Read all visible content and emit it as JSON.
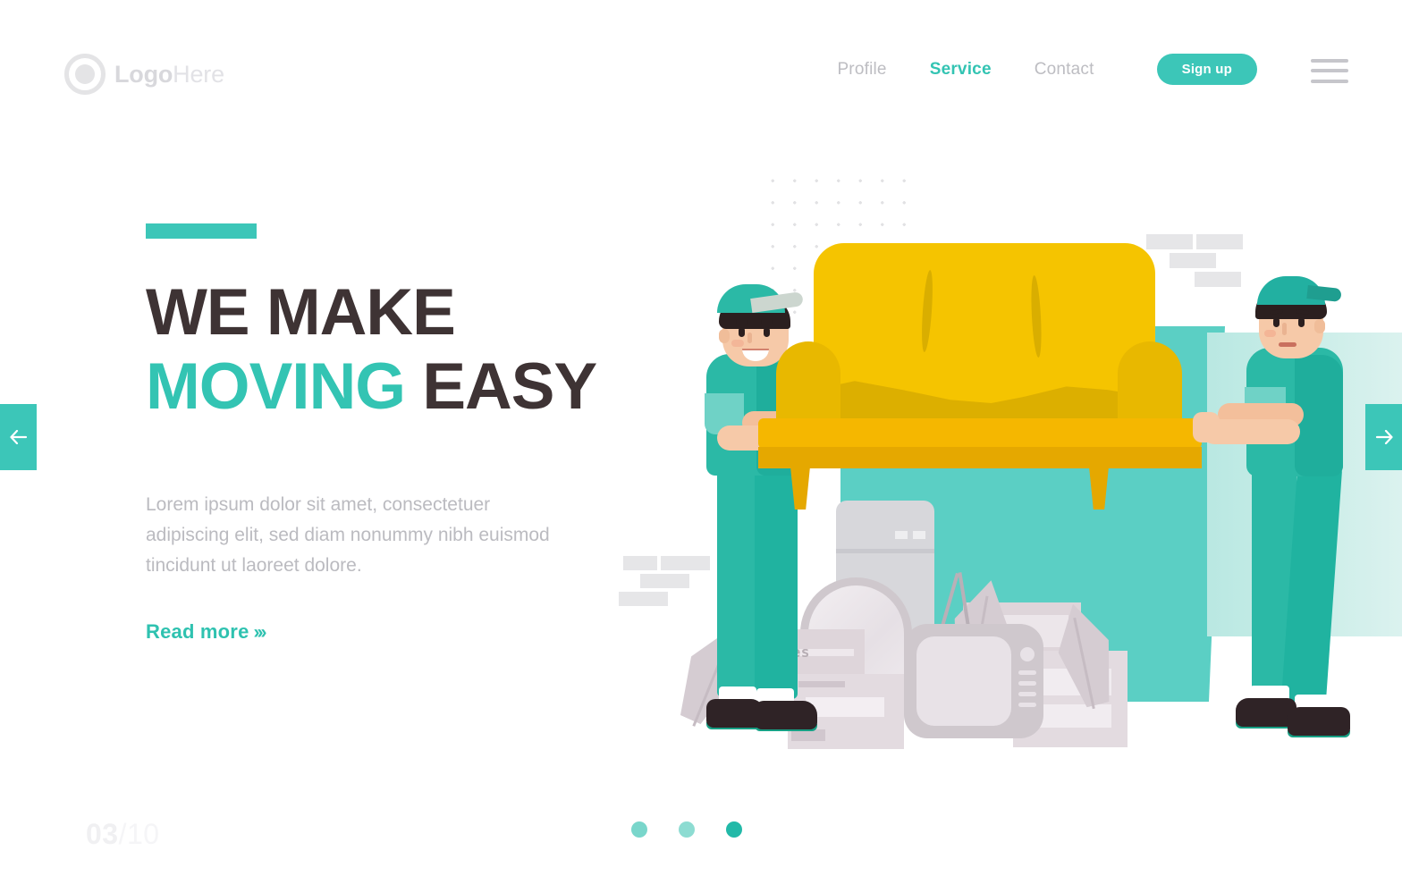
{
  "header": {
    "logo": {
      "bold": "Logo",
      "light": "Here",
      "icon": "circle-logo-icon"
    },
    "nav": [
      {
        "label": "Profile",
        "active": false
      },
      {
        "label": "Service",
        "active": true
      },
      {
        "label": "Contact",
        "active": false
      }
    ],
    "signup_label": "Sign up",
    "menu_icon": "hamburger-menu-icon"
  },
  "hero": {
    "title_line1": "WE MAKE",
    "title_accent": "MOVING",
    "title_line2_rest": " EASY",
    "paragraph": "Lorem ipsum dolor sit amet, consectetuer adipiscing elit, sed diam nonummy nibh euismod tincidunt ut laoreet dolore.",
    "cta_label": "Read more",
    "cta_chevrons": "»›"
  },
  "slider": {
    "prev_icon": "arrow-left-icon",
    "next_icon": "arrow-right-icon",
    "current": "03",
    "separator_total": "/10",
    "dots": [
      "dot-1",
      "dot-2",
      "dot-3-active"
    ]
  },
  "illustration": {
    "box_label": "Clothes",
    "alt": "two movers in teal uniforms carrying a large yellow sofa over stacked moving boxes, a fridge, a mirror and a television"
  },
  "colors": {
    "accent": "#3cc6b8",
    "accent_dark": "#22b9a8",
    "heading": "#3e3334",
    "muted": "#bbbbc0",
    "sofa": "#f5c400",
    "teal_block": "#5bcfc4"
  }
}
